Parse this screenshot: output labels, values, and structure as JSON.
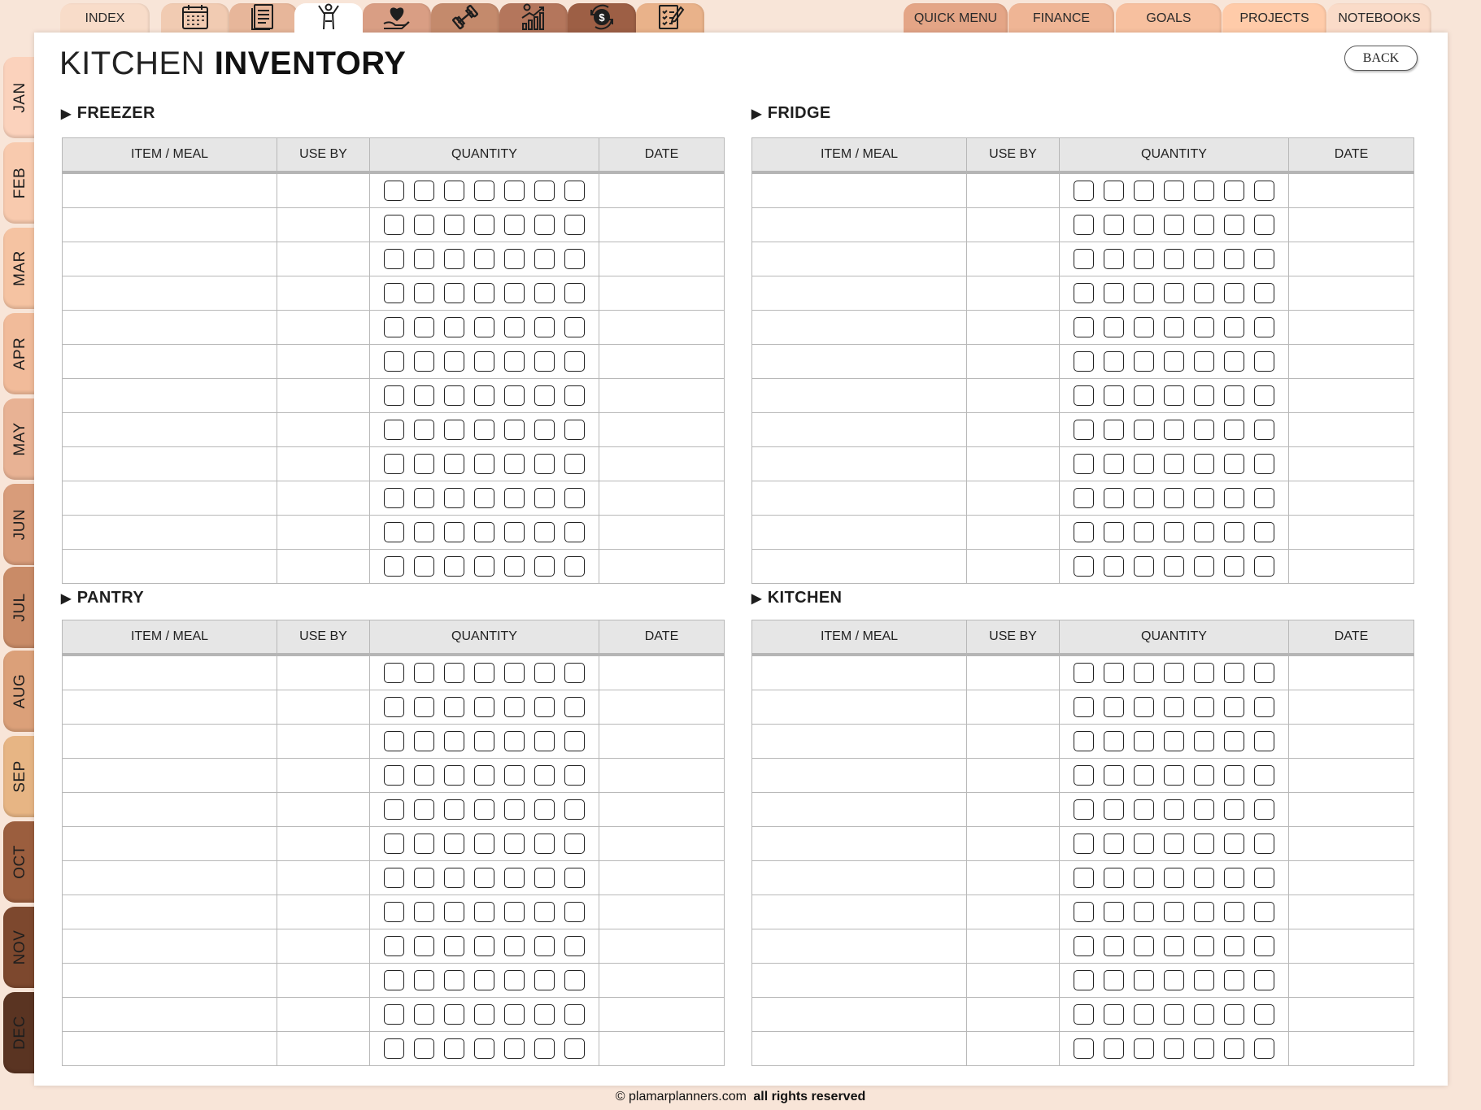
{
  "colors": {
    "background": "#f8e5d8",
    "tab_shades": [
      "#f8dcc9",
      "#f1cbb2",
      "#e7b69a",
      "#d99e84",
      "#c48a6c",
      "#b4765c",
      "#9d5f45",
      "#e9b28a",
      "#ffcba9"
    ],
    "month_shades": [
      "#fbd2bc",
      "#f8caae",
      "#f5c3a2",
      "#f1bb9a",
      "#e8b294",
      "#d89c7a",
      "#c98b67",
      "#dba079",
      "#e7b584",
      "#9b5e3e",
      "#7d482e",
      "#5a3422"
    ]
  },
  "top_tabs": [
    {
      "label": "INDEX",
      "icon": ""
    },
    {
      "label": "",
      "icon": "calendar-icon"
    },
    {
      "label": "",
      "icon": "notes-icon"
    },
    {
      "label": "",
      "icon": "wellness-person-icon"
    },
    {
      "label": "",
      "icon": "heart-hand-icon"
    },
    {
      "label": "",
      "icon": "dumbbell-icon"
    },
    {
      "label": "",
      "icon": "growth-chart-icon"
    },
    {
      "label": "",
      "icon": "money-exchange-icon"
    },
    {
      "label": "",
      "icon": "checklist-icon"
    }
  ],
  "right_tabs": [
    "QUICK MENU",
    "FINANCE",
    "GOALS",
    "PROJECTS",
    "NOTEBOOKS"
  ],
  "months": [
    "JAN",
    "FEB",
    "MAR",
    "APR",
    "MAY",
    "JUN",
    "JUL",
    "AUG",
    "SEP",
    "OCT",
    "NOV",
    "DEC"
  ],
  "page": {
    "title_light": "KITCHEN",
    "title_bold": "INVENTORY",
    "back_label": "BACK"
  },
  "columns": [
    "ITEM / MEAL",
    "USE BY",
    "QUANTITY",
    "DATE"
  ],
  "sections": [
    {
      "title": "FREEZER",
      "rows": 12,
      "boxes_per_row": 7
    },
    {
      "title": "FRIDGE",
      "rows": 12,
      "boxes_per_row": 7
    },
    {
      "title": "PANTRY",
      "rows": 12,
      "boxes_per_row": 7
    },
    {
      "title": "KITCHEN",
      "rows": 12,
      "boxes_per_row": 7
    }
  ],
  "footer": {
    "site": "© plamarplanners.com",
    "rights": "all rights reserved"
  }
}
